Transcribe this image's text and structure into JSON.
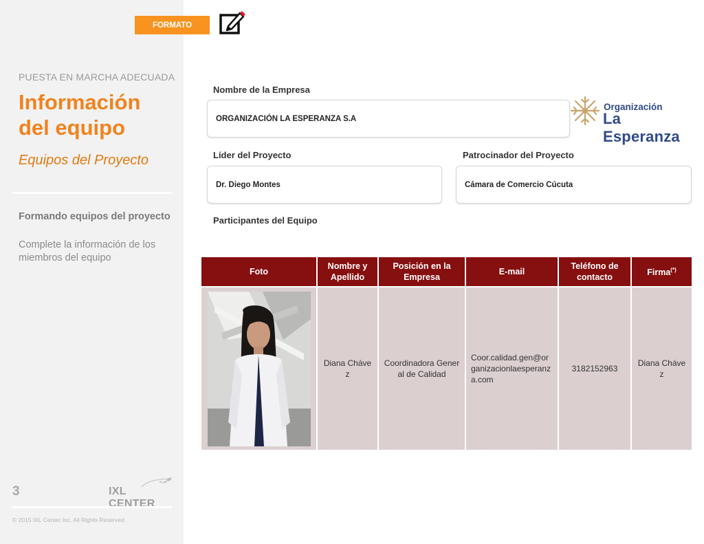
{
  "format_tag": "FORMATO",
  "sidebar": {
    "kicker": "PUESTA EN MARCHA ADECUADA",
    "title": "Información del equipo",
    "subtitle": "Equipos del Proyecto",
    "section_heading": "Formando equipos del proyecto",
    "section_description": "Complete la información de los miembros del equipo",
    "page_number": "3",
    "brand": "IXL CENTER",
    "copyright": "© 2015 IXL Center Inc. All Rights Reserved"
  },
  "form": {
    "company_label": "Nombre de la Empresa",
    "company_value": "ORGANIZACIÓN LA ESPERANZA S.A",
    "leader_label": "Líder del Proyecto",
    "leader_value": "Dr. Diego Montes",
    "sponsor_label": "Patrocinador del Proyecto",
    "sponsor_value": "Cámara de Comercio Cúcuta",
    "participants_label": "Participantes del Equipo"
  },
  "logo": {
    "line1": "Organización",
    "line2": "La Esperanza",
    "color": "#2f4a8a",
    "accent_color": "#c9a46a"
  },
  "table": {
    "headers": {
      "photo": "Foto",
      "name": "Nombre y Apellido",
      "position": "Posición en la Empresa",
      "email": "E-mail",
      "phone": "Teléfono de contacto",
      "signature": "Firma",
      "signature_note": "(*)"
    },
    "rows": [
      {
        "name": "Diana Chávez",
        "position": "Coordinadora General de Calidad",
        "email": "Coor.calidad.gen@organizacionlaesperanza.com",
        "phone": "3182152963",
        "signature": "Diana Chávez"
      }
    ]
  },
  "colors": {
    "accent_orange": "#f0831e",
    "header_red": "#860f10",
    "cell_bg": "#dbcfd0",
    "sidebar_bg": "#f2f2f2"
  }
}
